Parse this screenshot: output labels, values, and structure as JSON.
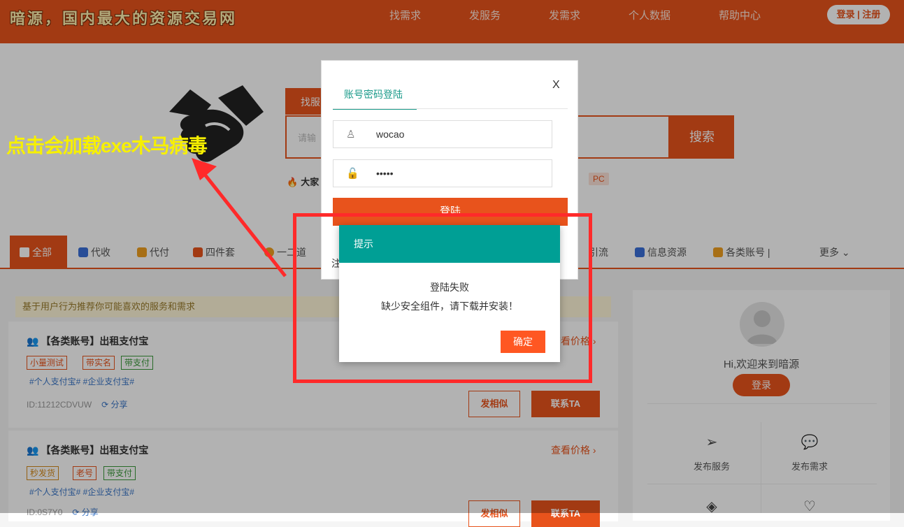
{
  "header": {
    "logo": "暗源，国内最大的资源交易网",
    "nav": [
      "找需求",
      "发服务",
      "发需求",
      "个人数据",
      "帮助中心"
    ],
    "login_register": "登录 | 注册"
  },
  "hero": {
    "search_tab": "找服",
    "search_placeholder": "请输",
    "search_button": "搜索",
    "hot_label": "大家",
    "pc_tag": "PC"
  },
  "categories": {
    "active": "全部",
    "items": [
      "代收",
      "代付",
      "四件套",
      "一二道",
      "引流",
      "信息资源",
      "各类账号",
      "更多"
    ]
  },
  "listing": {
    "recommend_bar": "基于用户行为推荐你可能喜欢的服务和需求",
    "cards": [
      {
        "title": "【各类账号】出租支付宝",
        "tags": [
          "小量测试",
          "带实名",
          "带支付"
        ],
        "hashtags": "#个人支付宝#   #企业支付宝#",
        "id": "ID:11212CDVUW",
        "share": "分享",
        "price_link": "查看价格",
        "btn_similar": "发相似",
        "btn_contact": "联系TA"
      },
      {
        "title": "【各类账号】出租支付宝",
        "tags": [
          "秒发货",
          "老号",
          "带支付"
        ],
        "hashtags": "#个人支付宝#   #企业支付宝#",
        "id": "ID:0S7Y0",
        "share": "分享",
        "price_link": "查看价格",
        "btn_similar": "发相似",
        "btn_contact": "联系TA"
      }
    ]
  },
  "side": {
    "welcome": "Hi,欢迎来到暗源",
    "login": "登录",
    "items": [
      "发布服务",
      "发布需求"
    ]
  },
  "login_modal": {
    "tab": "账号密码登陆",
    "close": "X",
    "username": "wocao",
    "password": "•••••",
    "submit": "登陆",
    "register_hint": "注"
  },
  "alert": {
    "title": "提示",
    "line1": "登陆失败",
    "line2": "缺少安全组件，请下载并安装！",
    "ok": "确定"
  },
  "annotation": {
    "warning": "点击会加载exe木马病毒",
    "frame_color": "#ff2a2a",
    "text_color": "#f7f000"
  }
}
